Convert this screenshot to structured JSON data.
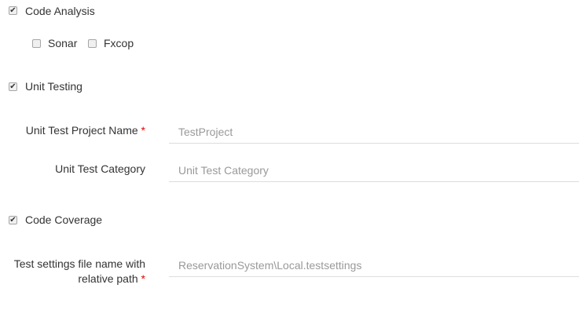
{
  "code_analysis": {
    "label": "Code Analysis",
    "checked": true,
    "options": [
      {
        "label": "Sonar",
        "checked": false
      },
      {
        "label": "Fxcop",
        "checked": false
      }
    ]
  },
  "unit_testing": {
    "label": "Unit Testing",
    "checked": true,
    "project_name": {
      "label": "Unit Test Project Name",
      "required": "*",
      "value": "TestProject"
    },
    "category": {
      "label": "Unit Test Category",
      "placeholder": "Unit Test Category"
    }
  },
  "code_coverage": {
    "label": "Code Coverage",
    "checked": true,
    "settings_file": {
      "label_line1": "Test settings file name with",
      "label_line2": "relative path",
      "required": "*",
      "value": "ReservationSystem\\Local.testsettings"
    }
  },
  "check_glyph": "✔"
}
